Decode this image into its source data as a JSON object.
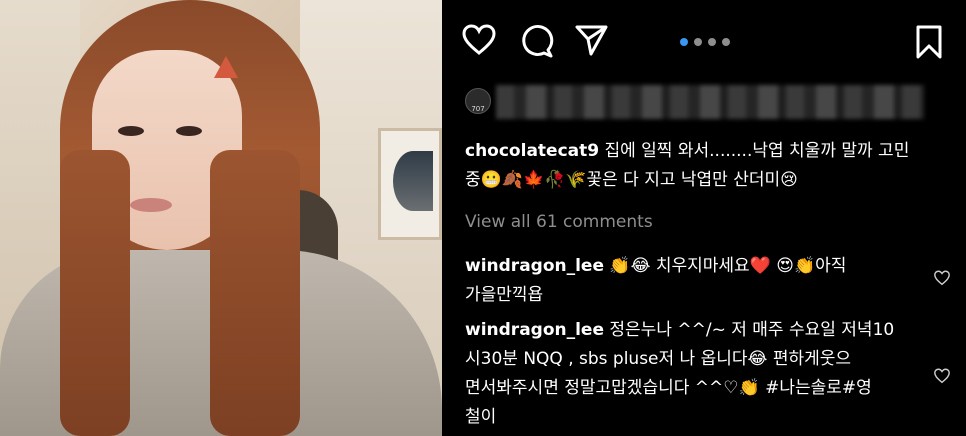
{
  "post": {
    "author": "chocolatecat9",
    "caption_line1": "집에 일찍 와서........낙엽 치울까 말까 고민",
    "caption_line2_prefix": "중",
    "caption_line2_suffix": "꽃은 다 지고 낙엽만 산더미",
    "avatar_text": "707"
  },
  "view_comments": "View all 61 comments",
  "comments": [
    {
      "user": "windragon_lee",
      "line1_a": "치우지마세요",
      "line1_b": "아직",
      "line2": "가을만끽욥"
    },
    {
      "user": "windragon_lee",
      "line1": "정은누나 ^^/~ 저 매주 수요일 저녁10",
      "line2_a": "시30분 NQQ ,  sbs pluse저 나 옵니다",
      "line2_b": "편하게웃으",
      "line3_a": "면서봐주시면 정말고맙겠습니다 ^^♡",
      "line3_b": "#나는솔로#영",
      "line4": "철이"
    }
  ],
  "icons": [
    "heart-icon",
    "comment-icon",
    "share-icon",
    "bookmark-icon",
    "carousel-dots",
    "comment-like-icon"
  ],
  "colors": {
    "background": "#000000",
    "text": "#ffffff",
    "muted": "#8e8e8e",
    "active_dot": "#3897f0"
  }
}
